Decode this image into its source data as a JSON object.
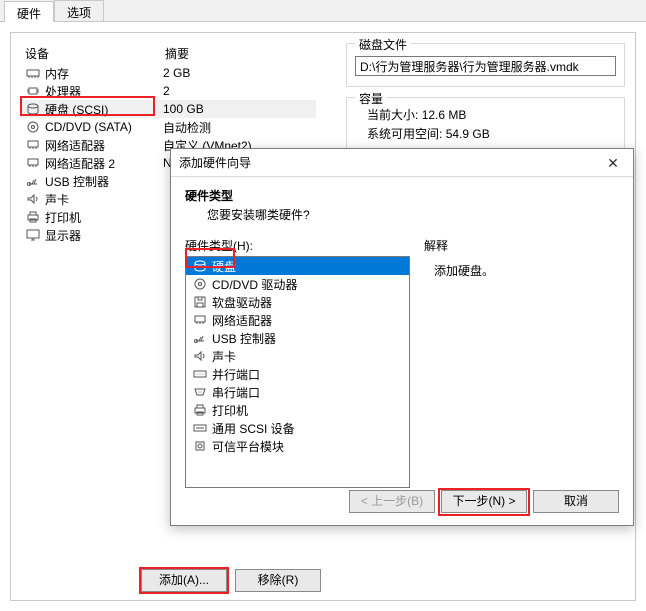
{
  "tabs": {
    "hardware": "硬件",
    "options": "选项"
  },
  "headers": {
    "device": "设备",
    "summary": "摘要"
  },
  "devices": [
    {
      "icon": "memory",
      "name": "内存",
      "summary": "2 GB"
    },
    {
      "icon": "cpu",
      "name": "处理器",
      "summary": "2"
    },
    {
      "icon": "disk",
      "name": "硬盘 (SCSI)",
      "summary": "100 GB",
      "selected": true
    },
    {
      "icon": "cd",
      "name": "CD/DVD (SATA)",
      "summary": "自动检测"
    },
    {
      "icon": "net",
      "name": "网络适配器",
      "summary": "自定义 (VMnet2)"
    },
    {
      "icon": "net",
      "name": "网络适配器 2",
      "summary": "NAT"
    },
    {
      "icon": "usb",
      "name": "USB 控制器",
      "summary": ""
    },
    {
      "icon": "sound",
      "name": "声卡",
      "summary": ""
    },
    {
      "icon": "printer",
      "name": "打印机",
      "summary": ""
    },
    {
      "icon": "display",
      "name": "显示器",
      "summary": ""
    }
  ],
  "right": {
    "disk_file_title": "磁盘文件",
    "disk_file_path": "D:\\行为管理服务器\\行为管理服务器.vmdk",
    "capacity_title": "容量",
    "current_size_label": "当前大小:",
    "current_size_value": "12.6 MB",
    "free_space_label": "系统可用空间:",
    "free_space_value": "54.9 GB"
  },
  "buttons": {
    "add": "添加(A)...",
    "remove": "移除(R)"
  },
  "wizard": {
    "title": "添加硬件向导",
    "heading": "硬件类型",
    "subheading": "您要安装哪类硬件?",
    "hw_types_label": "硬件类型(H):",
    "explain_label": "解释",
    "explain_text": "添加硬盘。",
    "items": [
      {
        "icon": "disk",
        "label": "硬盘",
        "selected": true
      },
      {
        "icon": "cd",
        "label": "CD/DVD 驱动器"
      },
      {
        "icon": "floppy",
        "label": "软盘驱动器"
      },
      {
        "icon": "net",
        "label": "网络适配器"
      },
      {
        "icon": "usb",
        "label": "USB 控制器"
      },
      {
        "icon": "sound",
        "label": "声卡"
      },
      {
        "icon": "parallel",
        "label": "并行端口"
      },
      {
        "icon": "serial",
        "label": "串行端口"
      },
      {
        "icon": "printer",
        "label": "打印机"
      },
      {
        "icon": "scsi",
        "label": "通用 SCSI 设备"
      },
      {
        "icon": "tpm",
        "label": "可信平台模块"
      }
    ],
    "btn_back": "< 上一步(B)",
    "btn_next": "下一步(N) >",
    "btn_cancel": "取消"
  }
}
